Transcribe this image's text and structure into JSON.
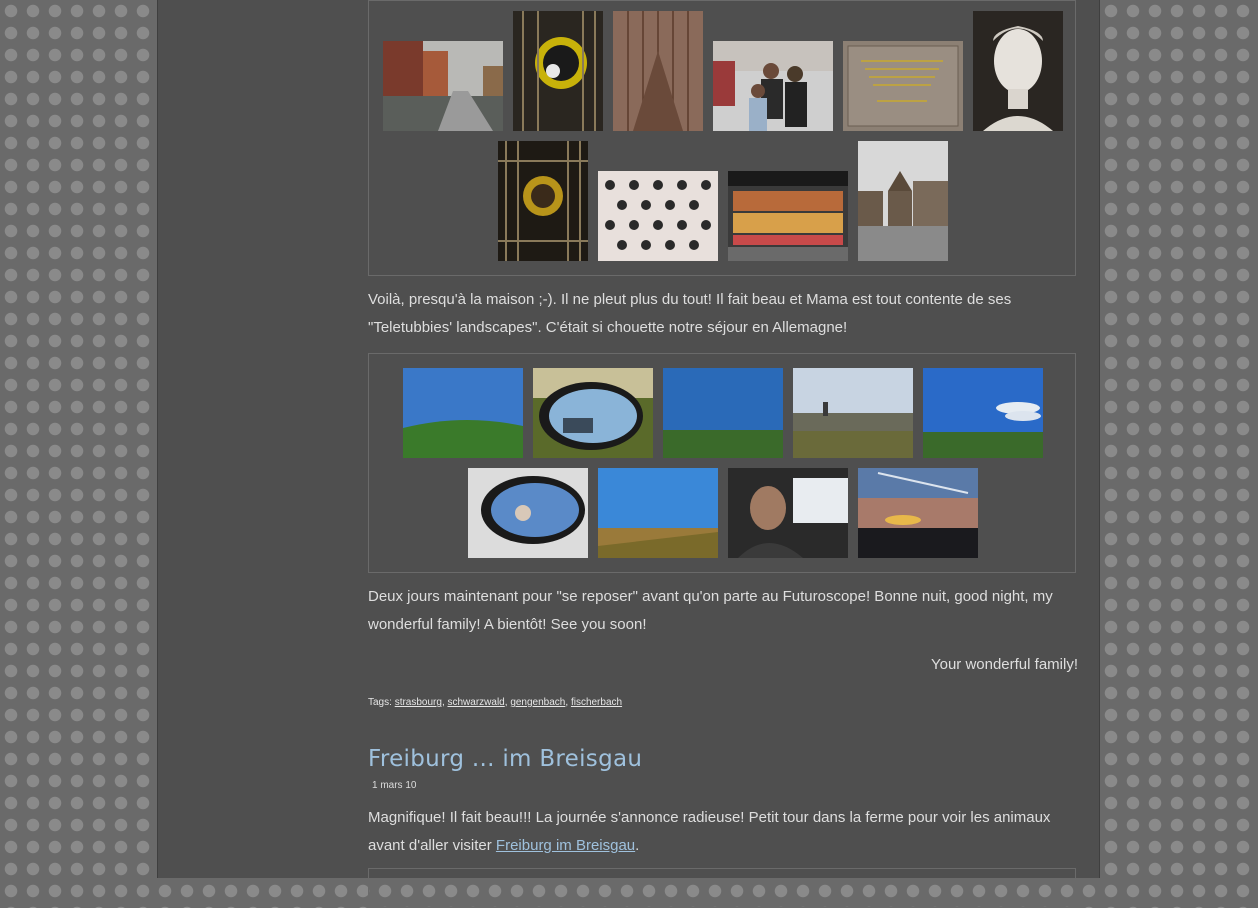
{
  "post1": {
    "paragraph1": "Voilà, presqu'à la maison ;-). Il ne pleut plus du tout! Il fait beau et Mama est tout contente de ses \"Teletubbies' landscapes\". C'était si chouette notre séjour en Allemagne!",
    "paragraph2": "Deux jours maintenant pour \"se reposer\" avant qu'on parte au Futuroscope! Bonne nuit, good night, my wonderful family! A bientôt! See you soon!",
    "signature": "Your wonderful family!",
    "tags_label": "Tags:",
    "tags": [
      "strasbourg",
      "schwarzwald",
      "gengenbach",
      "fischerbach"
    ]
  },
  "post2": {
    "title": "Freiburg ... im Breisgau",
    "date": "1 mars 10",
    "text_before_link": "Magnifique! Il fait beau!!! La journée s'annonce radieuse!  Petit tour dans la ferme pour voir les animaux avant d'aller visiter ",
    "link_text": "Freiburg im Breisgau",
    "text_after_link": "."
  }
}
